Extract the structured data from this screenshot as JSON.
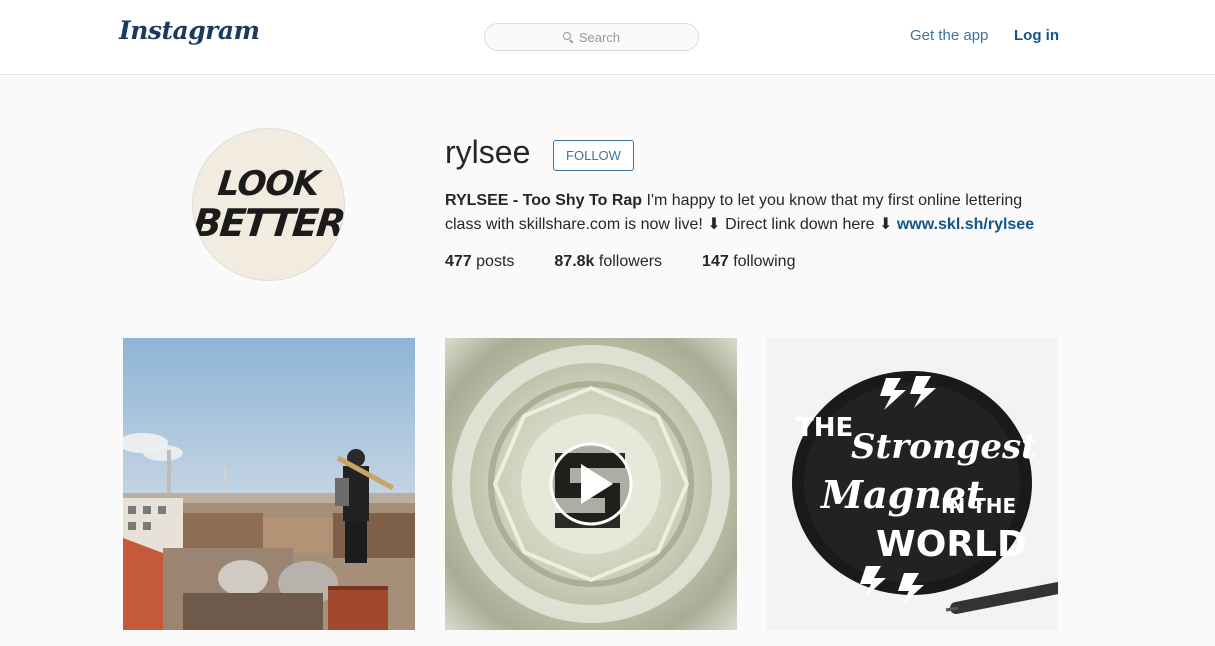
{
  "header": {
    "logo": "Instagram",
    "search_placeholder": "Search",
    "get_app": "Get the app",
    "login": "Log in"
  },
  "profile": {
    "avatar_text": [
      "LOOK",
      "BETTER"
    ],
    "username": "rylsee",
    "follow_label": "FOLLOW",
    "bio_name": "RYLSEE - Too Shy To Rap",
    "bio_text": " I'm happy to let you know that my first online lettering class with skillshare.com is now live! ⬇ Direct link down here ⬇ ",
    "bio_link": "www.skl.sh/rylsee",
    "stats": {
      "posts_count": "477",
      "posts_label": "posts",
      "followers_count": "87.8k",
      "followers_label": "followers",
      "following_count": "147",
      "following_label": "following"
    }
  },
  "posts": [
    {
      "type": "photo",
      "subject": "man on rooftop with bat"
    },
    {
      "type": "video",
      "subject": "glass with logo"
    },
    {
      "type": "photo",
      "subject": "lettering artwork",
      "art_text": [
        "THE",
        "Strongest",
        "Magnet",
        "IN THE",
        "WORLD"
      ]
    }
  ],
  "colors": {
    "link_blue": "#3f729b",
    "dark_blue": "#125688"
  }
}
